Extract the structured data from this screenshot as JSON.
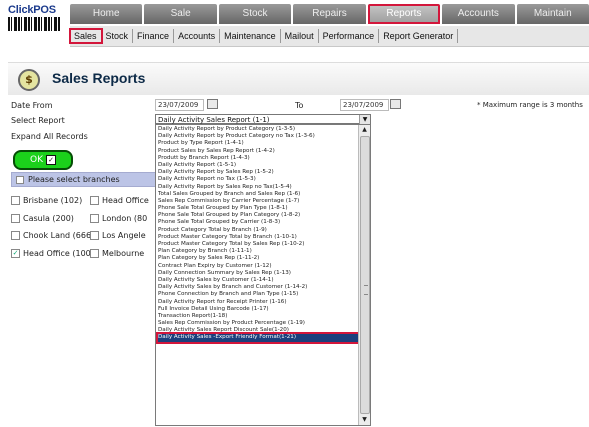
{
  "app": {
    "logo_text": "ClickPOS"
  },
  "top_nav": [
    "Home",
    "Sale",
    "Stock",
    "Repairs",
    "Reports",
    "Accounts",
    "Maintain"
  ],
  "top_nav_active": 4,
  "sub_nav": [
    "Sales",
    "Stock",
    "Finance",
    "Accounts",
    "Maintenance",
    "Mailout",
    "Performance",
    "Report Generator"
  ],
  "sub_nav_active": 0,
  "page": {
    "title": "Sales Reports",
    "icon": "dollar-coin-icon"
  },
  "form": {
    "date_from_label": "Date From",
    "date_from_value": "23/07/2009",
    "to_label": "To",
    "to_value": "23/07/2009",
    "max_range_note": "* Maximum range is 3 months",
    "select_report_label": "Select Report",
    "expand_all_label": "Expand All Records",
    "ok_label": "OK",
    "selected_report": "Daily Activity Sales Report (1-1)"
  },
  "branches": {
    "header_label": "Please select branches",
    "items": [
      {
        "label": "Brisbane (102)",
        "checked": false
      },
      {
        "label": "Head Office",
        "checked": false
      },
      {
        "label": "Casula (200)",
        "checked": false
      },
      {
        "label": "London (80",
        "checked": false
      },
      {
        "label": "Chook Land (666)",
        "checked": false
      },
      {
        "label": "Los Angele",
        "checked": false
      },
      {
        "label": "Head Office (100)",
        "checked": true
      },
      {
        "label": "Melbourne",
        "checked": false
      }
    ]
  },
  "dropdown_items": [
    "Daily Activity Report by Product Category (1-3-5)",
    "Daily Activity Report by Product Category no Tax (1-3-6)",
    "Product by Type Report (1-4-1)",
    "Product Sales by Sales Rep Report (1-4-2)",
    "Produtt by Branch Report (1-4-3)",
    "Daily Activity Report (1-5-1)",
    "Daily Activity Report by Sales Rep (1-5-2)",
    "Daily Activity Report no Tax (1-5-3)",
    "Daily Activity Report by Sales Rep no Tax(1-5-4)",
    "Total Sales Grouped by Branch and Sales Rep (1-6)",
    "Sales Rep Commission by Carrier Percentage (1-7)",
    "Phone Sale Total Grouped by Plan Type (1-8-1)",
    "Phone Sale Total Grouped by Plan Category (1-8-2)",
    "Phone Sale Total Grouped by Carrier (1-8-3)",
    "Product Category Total by Branch (1-9)",
    "Product Master Category Total by Branch (1-10-1)",
    "Product Master Category Total by Sales Rep (1-10-2)",
    "Plan Category by Branch (1-11-1)",
    "Plan Category by Sales Rep (1-11-2)",
    "Contract Plan Expiry by Customer (1-12)",
    "Daily Connection Summary by Sales Rep (1-13)",
    "Daily Activity Sales by Customer (1-14-1)",
    "Daily Activity Sales by Branch and Customer (1-14-2)",
    "Phone Connection by Branch and Plan Type (1-15)",
    "Daily Activity Report for Receipt Printer (1-16)",
    "Full Invoice Detail Using Barcode (1-17)",
    "Transaction Report(1-18)",
    "Sales Rep Commission by Product Percentage (1-19)",
    "Daily Activity Sales Report Discount Sale(1-20)",
    "Daily Activity Sales -Export Friendly Format(1-21)"
  ],
  "dropdown_selected_index": 29,
  "colors": {
    "highlight": "#d3163b",
    "ok_green": "#1bd11b",
    "selected_bg": "#1b3f7d"
  }
}
